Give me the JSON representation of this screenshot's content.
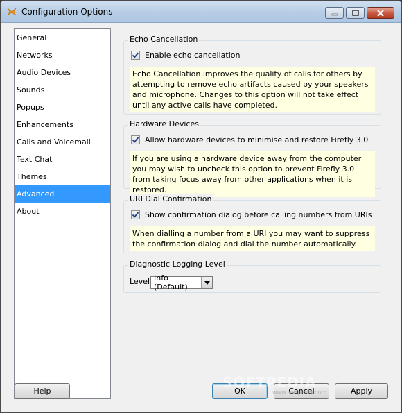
{
  "window": {
    "title": "Configuration Options"
  },
  "sidebar": {
    "items": [
      {
        "label": "General"
      },
      {
        "label": "Networks"
      },
      {
        "label": "Audio Devices"
      },
      {
        "label": "Sounds"
      },
      {
        "label": "Popups"
      },
      {
        "label": "Enhancements"
      },
      {
        "label": "Calls and Voicemail"
      },
      {
        "label": "Text Chat"
      },
      {
        "label": "Themes"
      },
      {
        "label": "Advanced",
        "selected": true
      },
      {
        "label": "About"
      }
    ]
  },
  "echo": {
    "title": "Echo Cancellation",
    "checkbox_label": "Enable echo cancellation",
    "checked": true,
    "info": "Echo Cancellation improves the quality of calls for others by attempting to remove echo artifacts caused by your speakers and microphone. Changes to this option will not take effect until any active calls have completed."
  },
  "hardware": {
    "title": "Hardware Devices",
    "checkbox_label": "Allow hardware devices to minimise and restore Firefly 3.0",
    "checked": true,
    "info": "If you are using a hardware device away from the computer you may wish to uncheck this option to prevent Firefly 3.0 from taking focus away from other applications when it is restored."
  },
  "uri": {
    "title": "URI Dial Confirmation",
    "checkbox_label": "Show confirmation dialog before calling numbers from URIs",
    "checked": true,
    "info": "When dialling a number from a URI you may want to suppress the confirmation dialog and dial the number automatically."
  },
  "logging": {
    "title": "Diagnostic Logging Level",
    "level_label": "Level",
    "level_value": "Info (Default)"
  },
  "buttons": {
    "help": "Help",
    "ok": "OK",
    "cancel": "Cancel",
    "apply": "Apply"
  },
  "watermark": {
    "text": "SOFTPEDIA",
    "url": "www.softpedia.com"
  },
  "colors": {
    "selection": "#3399ff",
    "info_bg": "#ffffe1",
    "title_bar": "#b7cde6"
  }
}
